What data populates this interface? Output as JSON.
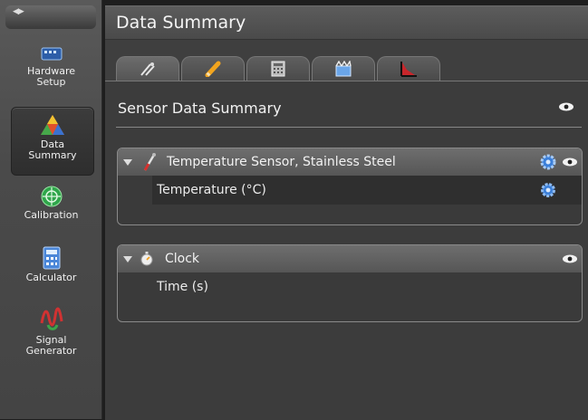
{
  "sidebar": {
    "items": [
      {
        "label": "Hardware\nSetup",
        "icon": "hardware-icon"
      },
      {
        "label": "Data\nSummary",
        "icon": "data-summary-icon"
      },
      {
        "label": "Calibration",
        "icon": "calibration-icon"
      },
      {
        "label": "Calculator",
        "icon": "calculator-icon"
      },
      {
        "label": "Signal\nGenerator",
        "icon": "signal-generator-icon"
      }
    ]
  },
  "header": {
    "title": "Data Summary"
  },
  "tabs": [
    {
      "icon": "sensor-probe-icon"
    },
    {
      "icon": "pencil-icon"
    },
    {
      "icon": "calculator-icon"
    },
    {
      "icon": "clapper-icon"
    },
    {
      "icon": "graph-icon"
    }
  ],
  "section": {
    "title": "Sensor Data Summary"
  },
  "groups": [
    {
      "title": "Temperature Sensor, Stainless Steel",
      "rows": [
        {
          "label": "Temperature (°C)"
        }
      ]
    },
    {
      "title": "Clock",
      "rows": [
        {
          "label": "Time (s)"
        }
      ]
    }
  ],
  "colors": {
    "accent_blue": "#3b7fd9",
    "background": "#3c3c3c"
  }
}
